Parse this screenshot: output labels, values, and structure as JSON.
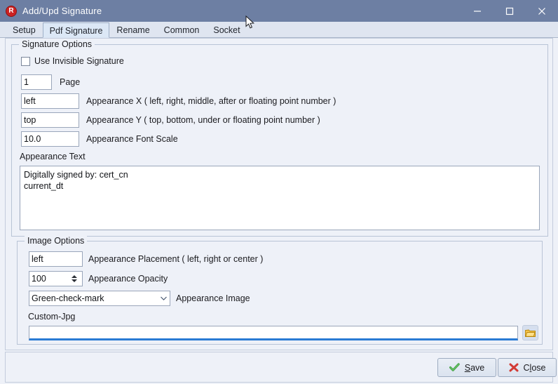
{
  "window": {
    "title": "Add/Upd Signature",
    "icon": "app-r-icon",
    "icon_letter": "R",
    "titlebar_color": "#6d7fa3",
    "controls": [
      {
        "name": "minimize-button",
        "glyph": "minimize-icon"
      },
      {
        "name": "maximize-button",
        "glyph": "maximize-icon"
      },
      {
        "name": "close-button",
        "glyph": "close-icon"
      }
    ]
  },
  "tabs": [
    {
      "label": "Setup",
      "active": false
    },
    {
      "label": "Pdf Signature",
      "active": true
    },
    {
      "label": "Rename",
      "active": false
    },
    {
      "label": "Common",
      "active": false
    },
    {
      "label": "Socket",
      "active": false
    }
  ],
  "signature_options": {
    "group_title": "Signature Options",
    "invisible_signature": {
      "label": "Use Invisible Signature",
      "checked": false
    },
    "page": {
      "value": "1",
      "label": "Page"
    },
    "appearance_x": {
      "value": "left",
      "label": "Appearance X ( left, right, middle, after or floating point number )"
    },
    "appearance_y": {
      "value": "top",
      "label": "Appearance Y ( top, bottom, under or floating point number )"
    },
    "appearance_font_scale": {
      "value": "10.0",
      "label": "Appearance Font Scale"
    },
    "appearance_text": {
      "label": "Appearance Text",
      "value": "Digitally signed by: cert_cn\ncurrent_dt"
    }
  },
  "image_options": {
    "group_title": "Image Options",
    "appearance_placement": {
      "value": "left",
      "label": "Appearance Placement ( left, right or center )"
    },
    "appearance_opacity": {
      "value": "100",
      "label": "Appearance Opacity"
    },
    "appearance_image": {
      "value": "Green-check-mark",
      "label": "Appearance Image"
    },
    "custom_jpg": {
      "label": "Custom-Jpg",
      "value": "",
      "placeholder": "",
      "focus_underline_color": "#2a7bd4",
      "browse_icon": "folder-icon"
    }
  },
  "footer": {
    "save": {
      "label_pre": "",
      "accel": "S",
      "label_post": "ave",
      "icon": "green-check-icon"
    },
    "close": {
      "label_pre": "C",
      "accel": "l",
      "label_post": "ose",
      "icon": "red-x-icon"
    }
  }
}
